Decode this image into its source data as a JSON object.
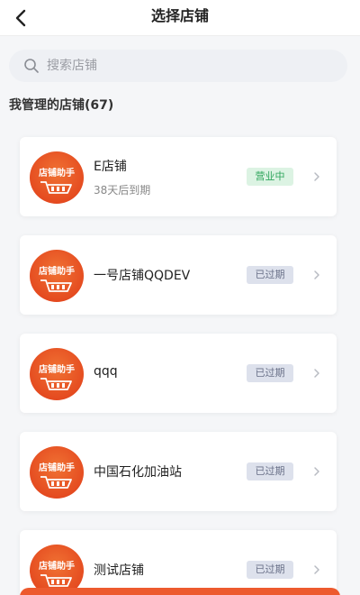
{
  "header": {
    "title": "选择店铺",
    "back_icon": "chevron-left-icon"
  },
  "search": {
    "placeholder": "搜索店铺",
    "value": ""
  },
  "section": {
    "title": "我管理的店铺(67)"
  },
  "avatar_text": "店铺助手",
  "colors": {
    "accent": "#ED5A2E",
    "open_badge_bg": "#DCF3E3",
    "open_badge_text": "#2FA55C",
    "expired_badge_bg": "#DDE1EC",
    "expired_badge_text": "#6A7189"
  },
  "shops": [
    {
      "name": "E店铺",
      "subtitle": "38天后到期",
      "status": "营业中"
    },
    {
      "name": "一号店铺QQDEV",
      "subtitle": "",
      "status": "已过期"
    },
    {
      "name": "qqq",
      "subtitle": "",
      "status": "已过期"
    },
    {
      "name": "中国石化加油站",
      "subtitle": "",
      "status": "已过期"
    },
    {
      "name": "测试店铺",
      "subtitle": "",
      "status": "已过期"
    }
  ]
}
